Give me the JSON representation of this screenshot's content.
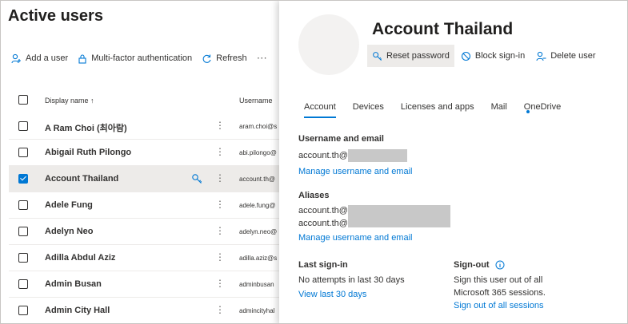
{
  "page_title": "Active users",
  "commands": {
    "add_user": "Add a user",
    "mfa": "Multi-factor authentication",
    "refresh": "Refresh",
    "more": "⋯"
  },
  "columns": {
    "display_name": "Display name",
    "sort_indicator": "↑",
    "username": "Username"
  },
  "users": [
    {
      "name": "A Ram Choi (최아람)",
      "username": "aram.choi@s"
    },
    {
      "name": "Abigail Ruth Pilongo",
      "username": "abi.pilongo@"
    },
    {
      "name": "Account Thailand",
      "username": "account.th@"
    },
    {
      "name": "Adele Fung",
      "username": "adele.fung@"
    },
    {
      "name": "Adelyn Neo",
      "username": "adelyn.neo@"
    },
    {
      "name": "Adilla Abdul Aziz",
      "username": "adilla.aziz@s"
    },
    {
      "name": "Admin Busan",
      "username": "adminbusan"
    },
    {
      "name": "Admin City Hall",
      "username": "admincityhal"
    }
  ],
  "row_actions": {
    "dots": "⋮"
  },
  "panel": {
    "name": "Account Thailand",
    "actions": {
      "reset_password": "Reset password",
      "block_signin": "Block sign-in",
      "delete_user": "Delete user"
    },
    "tabs": [
      "Account",
      "Devices",
      "Licenses and apps",
      "Mail",
      "OneDrive"
    ],
    "username_email": {
      "heading": "Username and email",
      "value": "account.th@",
      "link": "Manage username and email"
    },
    "aliases": {
      "heading": "Aliases",
      "values": [
        "account.th@",
        "account.th@"
      ],
      "link": "Manage username and email"
    },
    "last_signin": {
      "heading": "Last sign-in",
      "value": "No attempts in last 30 days",
      "link": "View last 30 days"
    },
    "signout": {
      "heading": "Sign-out",
      "desc_line1": "Sign this user out of all",
      "desc_line2": "Microsoft 365 sessions.",
      "link": "Sign out of all sessions"
    }
  },
  "colors": {
    "accent": "#0078d4",
    "selected_row": "#edebe9",
    "redaction": "#c8c8c8"
  }
}
